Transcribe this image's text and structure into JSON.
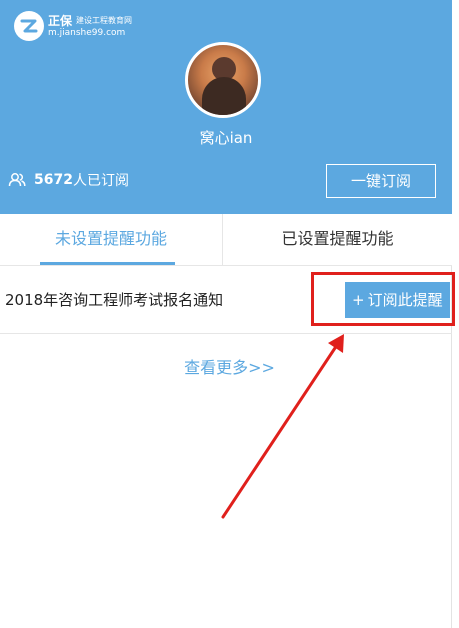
{
  "header": {
    "brand": "正保",
    "brand_sub": "建设工程教育网",
    "url": "m.jianshe99.com",
    "username": "窝心ian",
    "subscriber_count": "5672",
    "subscriber_suffix": "人已订阅",
    "one_key_label": "一键订阅"
  },
  "tabs": [
    {
      "label": "未设置提醒功能",
      "active": true
    },
    {
      "label": "已设置提醒功能",
      "active": false
    }
  ],
  "list": [
    {
      "title": "2018年咨询工程师考试报名通知",
      "button_label": "订阅此提醒"
    }
  ],
  "more_label": "查看更多>>",
  "colors": {
    "primary": "#5ca8e0",
    "annotation": "#e0201c"
  }
}
